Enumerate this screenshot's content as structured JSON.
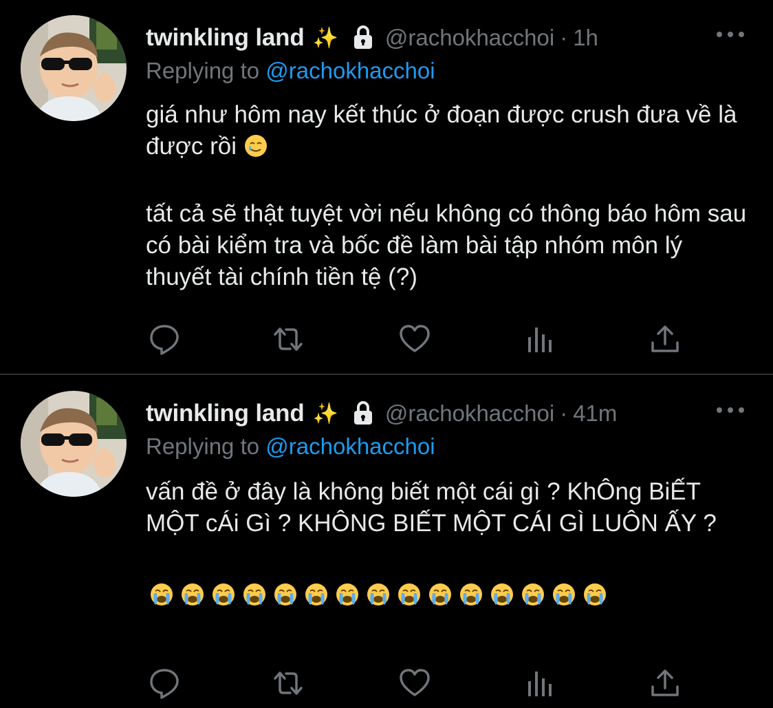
{
  "tweets": [
    {
      "display_name": "twinkling land",
      "sparkle_emoji": "✨",
      "handle": "@rachokhacchoi",
      "separator_dot": "·",
      "time": "1h",
      "replying_prefix": "Replying to",
      "replying_to": "@rachokhacchoi",
      "paragraph_1": "giá như hôm nay kết thúc ở đoạn được crush đưa về là được rồi",
      "paragraph_1_emoji": "tear-smile-emoji",
      "paragraph_2": "tất cả sẽ thật tuyệt vời nếu không có thông báo hôm sau có bài kiểm tra và bốc đề làm bài tập nhóm môn lý thuyết tài chính tiền tệ (?)"
    },
    {
      "display_name": "twinkling land",
      "sparkle_emoji": "✨",
      "handle": "@rachokhacchoi",
      "separator_dot": "·",
      "time": "41m",
      "replying_prefix": "Replying to",
      "replying_to": "@rachokhacchoi",
      "paragraph_1": "vấn đề ở đây là không biết một cái gì ? KhÔng BiẾT MỘT cÁi Gì ? KHÔNG BIẾT MỘT CÁI GÌ LUÔN ẤY ?",
      "crying_emoji_count": 15,
      "crying_emoji": "loudly-crying-face-emoji"
    }
  ],
  "actions": [
    "reply-icon",
    "retweet-icon",
    "like-icon",
    "views-icon",
    "share-icon"
  ],
  "colors": {
    "background": "#000000",
    "text": "#e7e9ea",
    "secondary": "#71767b",
    "link": "#1d9bf0",
    "divider": "#2f3336"
  }
}
